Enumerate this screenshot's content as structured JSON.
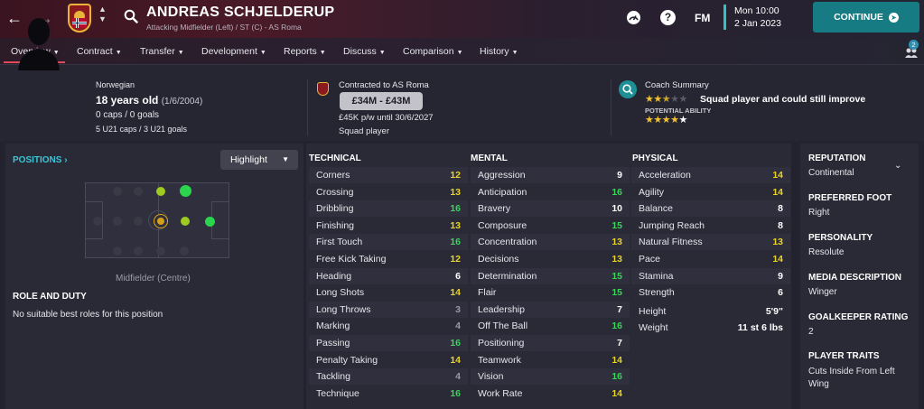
{
  "header": {
    "player_name": "ANDREAS SCHJELDERUP",
    "player_subtitle": "Attacking Midfielder (Left) / ST (C) - AS Roma",
    "fm_logo": "FM",
    "time": "Mon 10:00",
    "date": "2 Jan 2023",
    "continue_label": "CONTINUE",
    "accent": "#167b82"
  },
  "tabs": [
    {
      "label": "Overview"
    },
    {
      "label": "Contract"
    },
    {
      "label": "Transfer"
    },
    {
      "label": "Development"
    },
    {
      "label": "Reports"
    },
    {
      "label": "Discuss"
    },
    {
      "label": "Comparison"
    },
    {
      "label": "History"
    }
  ],
  "notification_count": "2",
  "profile": {
    "nationality": "Norwegian",
    "age_text": "18 years old",
    "dob": "(1/6/2004)",
    "caps": "0 caps / 0 goals",
    "u21_caps": "5 U21 caps / 3 U21 goals",
    "contract_label": "Contracted to AS Roma",
    "value": "£34M - £43M",
    "wage": "£45K p/w until 30/6/2027",
    "squad_status": "Squad player",
    "coach_title": "Coach Summary",
    "coach_summary": "Squad player and could still improve",
    "current_ability_stars": 2.5,
    "potential_label": "POTENTIAL ABILITY",
    "potential_ability_stars": 4.5
  },
  "positions": {
    "title": "POSITIONS",
    "highlight_label": "Highlight",
    "position_label": "Midfielder (Centre)",
    "role_title": "ROLE AND DUTY",
    "role_text": "No suitable best roles for this position"
  },
  "attributes": {
    "technical_title": "TECHNICAL",
    "mental_title": "MENTAL",
    "physical_title": "PHYSICAL",
    "technical": [
      {
        "name": "Corners",
        "value": "12"
      },
      {
        "name": "Crossing",
        "value": "13"
      },
      {
        "name": "Dribbling",
        "value": "16"
      },
      {
        "name": "Finishing",
        "value": "13"
      },
      {
        "name": "First Touch",
        "value": "16"
      },
      {
        "name": "Free Kick Taking",
        "value": "12"
      },
      {
        "name": "Heading",
        "value": "6"
      },
      {
        "name": "Long Shots",
        "value": "14"
      },
      {
        "name": "Long Throws",
        "value": "3"
      },
      {
        "name": "Marking",
        "value": "4"
      },
      {
        "name": "Passing",
        "value": "16"
      },
      {
        "name": "Penalty Taking",
        "value": "14"
      },
      {
        "name": "Tackling",
        "value": "4"
      },
      {
        "name": "Technique",
        "value": "16"
      }
    ],
    "mental": [
      {
        "name": "Aggression",
        "value": "9"
      },
      {
        "name": "Anticipation",
        "value": "16"
      },
      {
        "name": "Bravery",
        "value": "10"
      },
      {
        "name": "Composure",
        "value": "15"
      },
      {
        "name": "Concentration",
        "value": "13"
      },
      {
        "name": "Decisions",
        "value": "13"
      },
      {
        "name": "Determination",
        "value": "15"
      },
      {
        "name": "Flair",
        "value": "15"
      },
      {
        "name": "Leadership",
        "value": "7"
      },
      {
        "name": "Off The Ball",
        "value": "16"
      },
      {
        "name": "Positioning",
        "value": "7"
      },
      {
        "name": "Teamwork",
        "value": "14"
      },
      {
        "name": "Vision",
        "value": "16"
      },
      {
        "name": "Work Rate",
        "value": "14"
      }
    ],
    "physical": [
      {
        "name": "Acceleration",
        "value": "14"
      },
      {
        "name": "Agility",
        "value": "14"
      },
      {
        "name": "Balance",
        "value": "8"
      },
      {
        "name": "Jumping Reach",
        "value": "8"
      },
      {
        "name": "Natural Fitness",
        "value": "13"
      },
      {
        "name": "Pace",
        "value": "14"
      },
      {
        "name": "Stamina",
        "value": "9"
      },
      {
        "name": "Strength",
        "value": "6"
      }
    ],
    "height_label": "Height",
    "height": "5'9\"",
    "weight_label": "Weight",
    "weight": "11 st 6 lbs"
  },
  "info": {
    "reputation_title": "REPUTATION",
    "reputation": "Continental",
    "foot_title": "PREFERRED FOOT",
    "foot": "Right",
    "personality_title": "PERSONALITY",
    "personality": "Resolute",
    "media_title": "MEDIA DESCRIPTION",
    "media": "Winger",
    "gk_title": "GOALKEEPER RATING",
    "gk": "2",
    "traits_title": "PLAYER TRAITS",
    "traits": "Cuts Inside From Left Wing"
  }
}
